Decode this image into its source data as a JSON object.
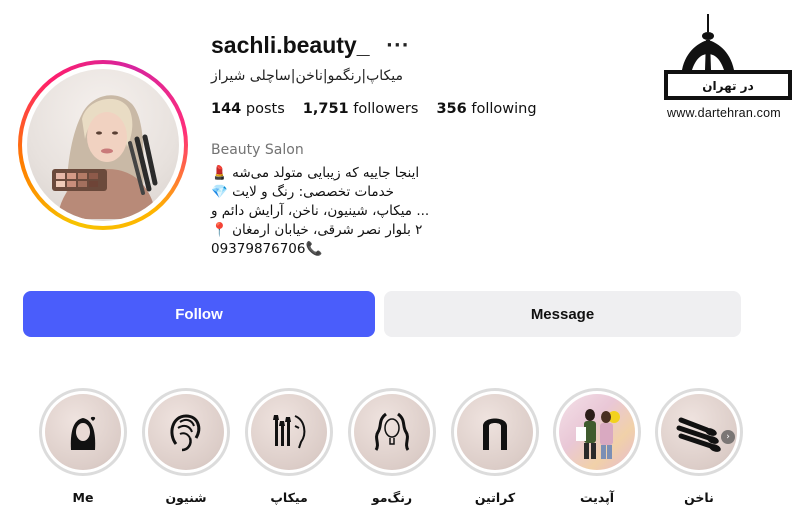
{
  "profile": {
    "username": "sachli.beauty_",
    "more_icon": "ellipsis-icon",
    "full_name": "میکاپ|رنگمو|ناخن|ساچلی شیراز",
    "stats": {
      "posts_count": "144",
      "posts_label": "posts",
      "followers_count": "1,751",
      "followers_label": "followers",
      "following_count": "356",
      "following_label": "following"
    },
    "category": "Beauty Salon",
    "bio_lines": [
      "اینجا جاییه که زیبایی متولد می‌شه 💄",
      "خدمات تخصصی: رنگ و لایت 💎",
      "... میکاپ، شینیون، ناخن، آرایش دائم و",
      "۲ بلوار نصر شرقی، خیابان ارمغان 📍",
      "09379876706📞"
    ]
  },
  "actions": {
    "follow_label": "Follow",
    "message_label": "Message",
    "follow_color": "#4a5dfb"
  },
  "highlights": [
    {
      "label": "Me",
      "icon": "woman-portrait-icon"
    },
    {
      "label": "شنیون",
      "icon": "hair-updo-icon"
    },
    {
      "label": "میکاپ",
      "icon": "makeup-brushes-face-icon"
    },
    {
      "label": "رنگ‌مو",
      "icon": "wavy-hair-icon"
    },
    {
      "label": "کراتین",
      "icon": "straight-hair-icon"
    },
    {
      "label": "آپدیت",
      "icon": "photo-highlight-icon"
    },
    {
      "label": "ناخن",
      "icon": "nails-icon"
    }
  ],
  "watermark": {
    "logo_text": "در تهران",
    "url": "www.dartehran.com"
  }
}
